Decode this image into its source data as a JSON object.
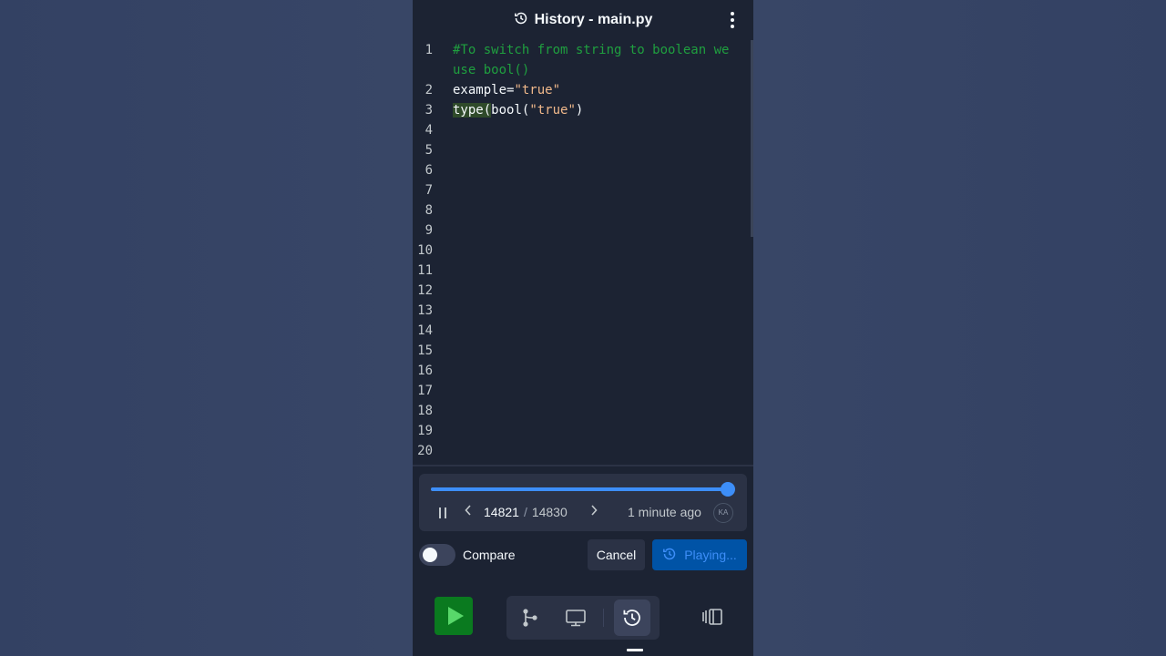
{
  "header": {
    "title": "History - main.py",
    "history_icon": "history-icon",
    "menu_icon": "kebab-menu-icon"
  },
  "editor": {
    "lines": [
      {
        "n": "1",
        "segments": [
          {
            "t": "#To switch from string to boolean we",
            "c": "cmt"
          }
        ]
      },
      {
        "n": "",
        "segments": [
          {
            "t": "use bool()",
            "c": "cmt"
          }
        ]
      },
      {
        "n": "2",
        "segments": [
          {
            "t": "example=",
            "c": ""
          },
          {
            "t": "\"true\"",
            "c": "str"
          }
        ]
      },
      {
        "n": "3",
        "segments": [
          {
            "t": "type(",
            "c": "fn-hl"
          },
          {
            "t": "bool(",
            "c": ""
          },
          {
            "t": "\"true\"",
            "c": "str"
          },
          {
            "t": ")",
            "c": ""
          }
        ]
      },
      {
        "n": "4",
        "segments": []
      },
      {
        "n": "5",
        "segments": []
      },
      {
        "n": "6",
        "segments": []
      },
      {
        "n": "7",
        "segments": []
      },
      {
        "n": "8",
        "segments": []
      },
      {
        "n": "9",
        "segments": []
      },
      {
        "n": "10",
        "segments": []
      },
      {
        "n": "11",
        "segments": []
      },
      {
        "n": "12",
        "segments": []
      },
      {
        "n": "13",
        "segments": []
      },
      {
        "n": "14",
        "segments": []
      },
      {
        "n": "15",
        "segments": []
      },
      {
        "n": "16",
        "segments": []
      },
      {
        "n": "17",
        "segments": []
      },
      {
        "n": "18",
        "segments": []
      },
      {
        "n": "19",
        "segments": []
      },
      {
        "n": "20",
        "segments": []
      }
    ]
  },
  "player": {
    "progress": 0.9994,
    "current": "14821",
    "separator": "/",
    "total": "14830",
    "time_ago": "1 minute ago",
    "avatar_initials": "KA"
  },
  "actions": {
    "compare_label": "Compare",
    "compare_on": false,
    "cancel_label": "Cancel",
    "playing_label": "Playing..."
  },
  "dock": {
    "run_icon": "run-play-icon",
    "items": [
      "git-branch-icon",
      "monitor-icon",
      "history-icon"
    ],
    "active_item": "history-icon",
    "split_icon": "split-view-icon"
  },
  "colors": {
    "background": "#334163",
    "panel": "#1c2333",
    "surface": "#2b3245",
    "accent": "#3d8ef8",
    "run_green": "#0a7a1f",
    "comment_green": "#1f9f3f",
    "string": "#f0b88a"
  }
}
